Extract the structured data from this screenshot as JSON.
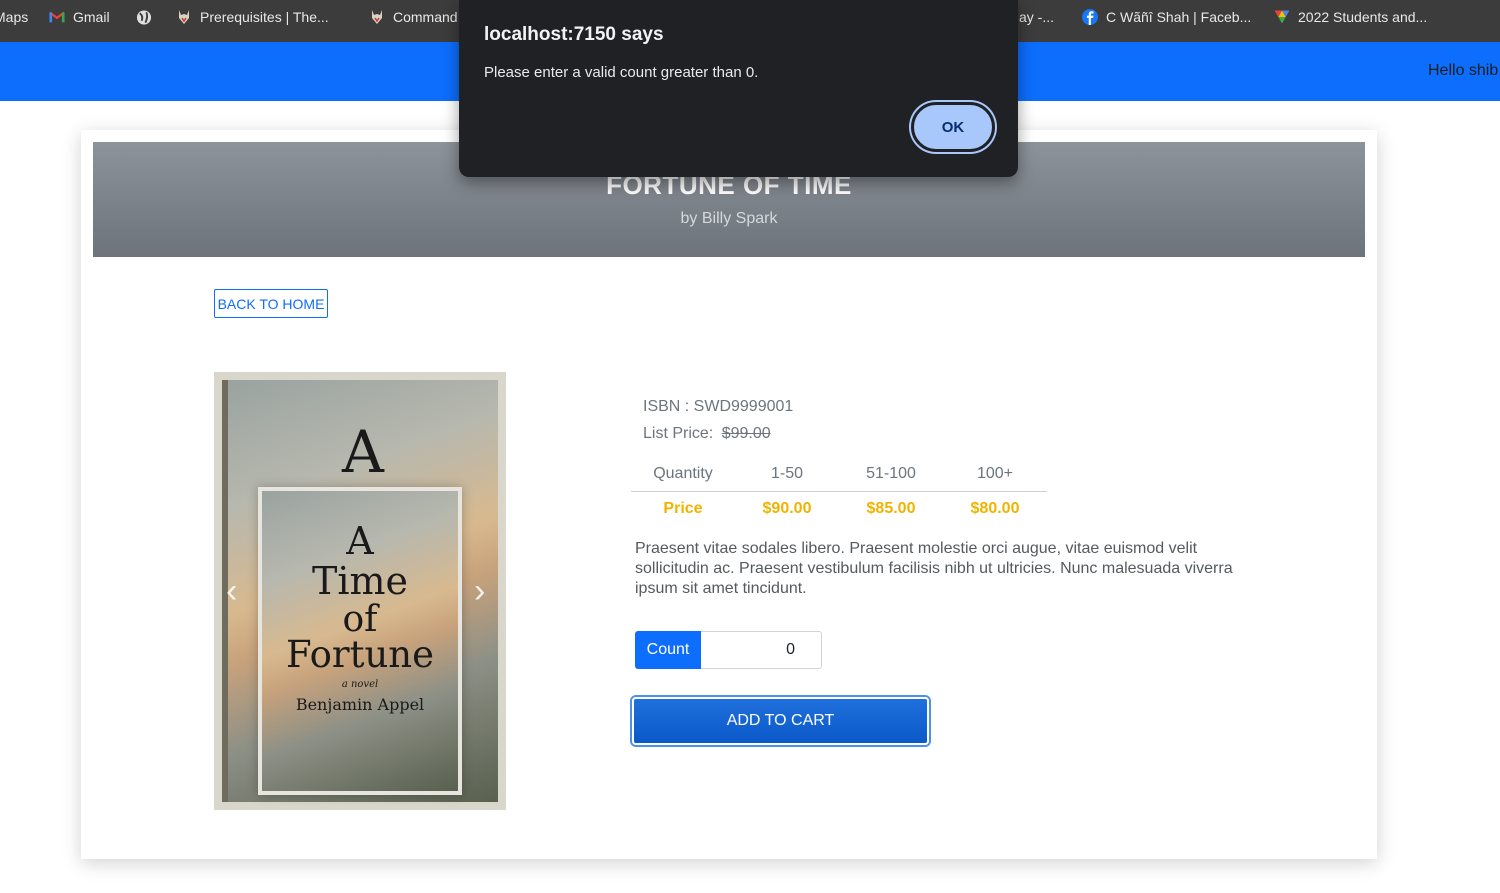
{
  "bookmarks": [
    {
      "label": "Maps",
      "icon": "maps-icon"
    },
    {
      "label": "Gmail",
      "icon": "gmail-icon"
    },
    {
      "label": "",
      "icon": "globe-icon"
    },
    {
      "label": "Prerequisites | The...",
      "icon": "wolf-icon"
    },
    {
      "label": "Command",
      "icon": "wolf-icon"
    },
    {
      "label": "ay -...",
      "icon": "page-icon"
    },
    {
      "label": "C Wãñî Shah | Faceb...",
      "icon": "facebook-icon"
    },
    {
      "label": "2022 Students and...",
      "icon": "drive-icon"
    }
  ],
  "navbar": {
    "greeting": "Hello shib",
    "color": "#0d6efd"
  },
  "dialog": {
    "title": "localhost:7150 says",
    "message": "Please enter a valid count greater than 0.",
    "ok_label": "OK"
  },
  "book": {
    "title": "FORTUNE OF TIME",
    "author": "by Billy Spark",
    "isbn": "ISBN : SWD9999001",
    "list_price_label": "List Price:",
    "list_price": "$99.00",
    "description": "Praesent vitae sodales libero. Praesent molestie orci augue, vitae euismod velit sollicitudin ac. Praesent vestibulum facilisis nibh ut ultricies. Nunc malesuada viverra ipsum sit amet tincidunt."
  },
  "back_button": "BACK TO HOME",
  "pricing": {
    "headers": [
      "Quantity",
      "1-50",
      "51-100",
      "100+"
    ],
    "row": [
      "Price",
      "$90.00",
      "$85.00",
      "$80.00"
    ]
  },
  "cover": {
    "lines": [
      "A",
      "Time",
      "of",
      "Fortune",
      "a novel",
      "Benjamin Appel"
    ]
  },
  "count": {
    "label": "Count",
    "value": "0"
  },
  "add_to_cart": "ADD TO CART"
}
